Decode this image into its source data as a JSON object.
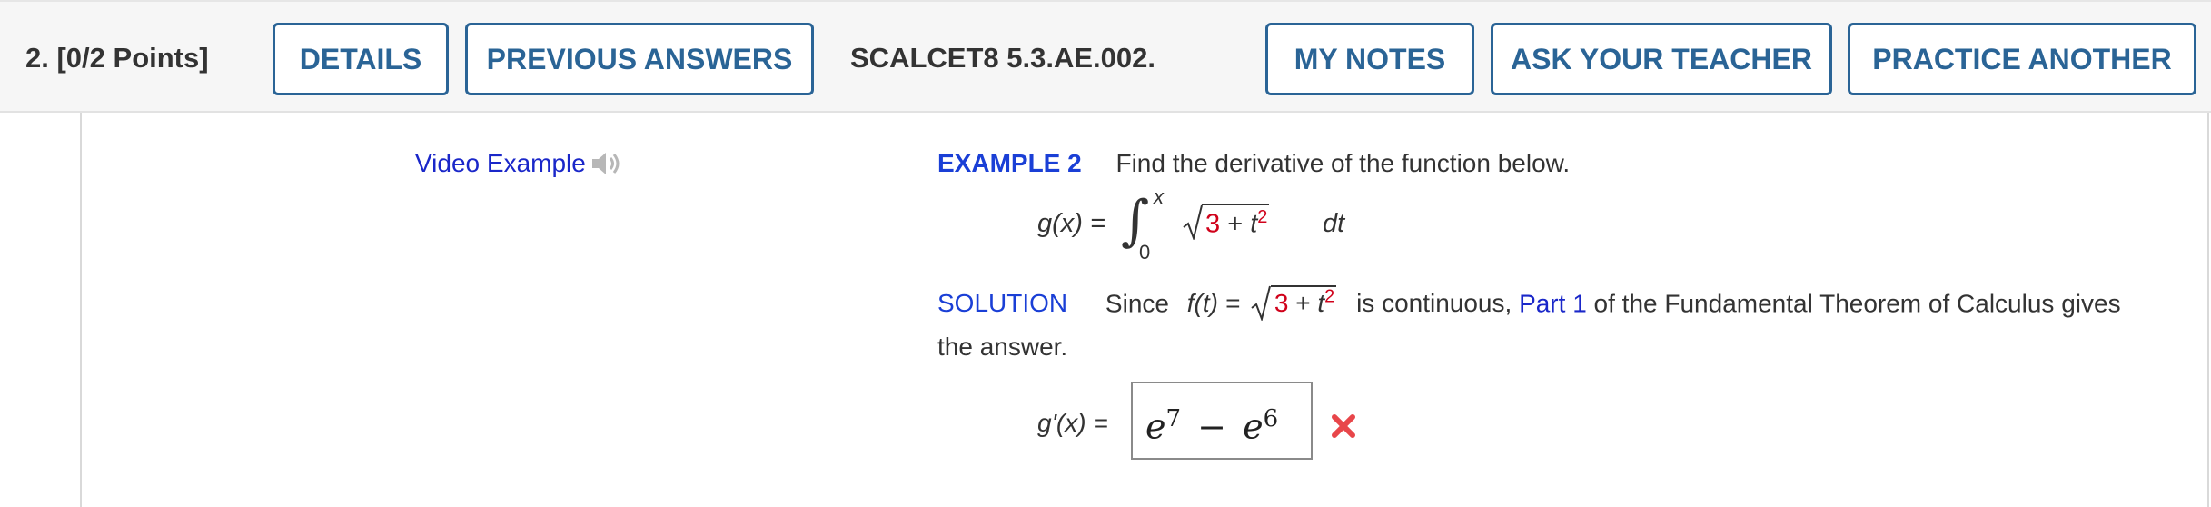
{
  "header": {
    "question_number": "2.",
    "points": "[0/2 Points]",
    "buttons": {
      "details": "DETAILS",
      "previous_answers": "PREVIOUS ANSWERS",
      "my_notes": "MY NOTES",
      "ask_teacher": "ASK YOUR TEACHER",
      "practice_another": "PRACTICE ANOTHER"
    },
    "question_id": "SCALCET8 5.3.AE.002.",
    "accent_color": "#2a6496"
  },
  "video": {
    "label": "Video Example",
    "icon": "speaker-icon"
  },
  "example": {
    "label": "EXAMPLE 2",
    "prompt": "Find the derivative of the function below."
  },
  "equation": {
    "lhs": "g(x) =",
    "upper_limit": "x",
    "lower_limit": "0",
    "radicand_red": "3",
    "radicand_plus": "+",
    "radicand_var": "t",
    "radicand_exp": "2",
    "differential": "dt"
  },
  "solution": {
    "label": "SOLUTION",
    "text_before": "Since",
    "f_of_t": "f(t) =",
    "radicand_red": "3",
    "radicand_plus": "+",
    "radicand_var": "t",
    "radicand_exp": "2",
    "text_middle": "is continuous,",
    "link_text": "Part 1",
    "text_after": "of the Fundamental Theorem of Calculus gives",
    "continuation": "the answer."
  },
  "answer": {
    "label": "g'(x) =",
    "value_base1": "e",
    "value_exp1": "7",
    "value_minus": "−",
    "value_base2": "e",
    "value_exp2": "6",
    "status": "incorrect",
    "status_color": "#e8464a"
  }
}
